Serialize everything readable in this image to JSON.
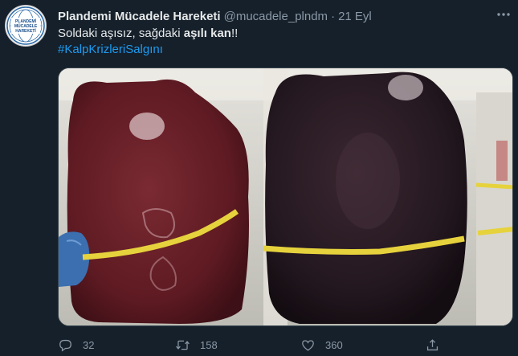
{
  "tweet": {
    "author_name": "Plandemi Mücadele Hareketi",
    "handle": "@mucadele_plndm",
    "separator": "·",
    "timestamp": "21 Eyl",
    "text_part1": "Soldaki aşısız, sağdaki ",
    "text_bold": "aşılı kan",
    "text_part2": "!!",
    "hashtag": "#KalpKrizleriSalgını",
    "avatar_text": [
      "PLANDEMİ",
      "MÜCADELE",
      "HAREKETİ"
    ]
  },
  "actions": {
    "reply_count": "32",
    "retweet_count": "158",
    "like_count": "360"
  },
  "colors": {
    "background": "#15202b",
    "text": "#e7e9ea",
    "muted": "#8b98a5",
    "link": "#1d9bf0"
  },
  "icons": [
    "more-icon",
    "reply-icon",
    "retweet-icon",
    "like-icon",
    "share-icon"
  ]
}
